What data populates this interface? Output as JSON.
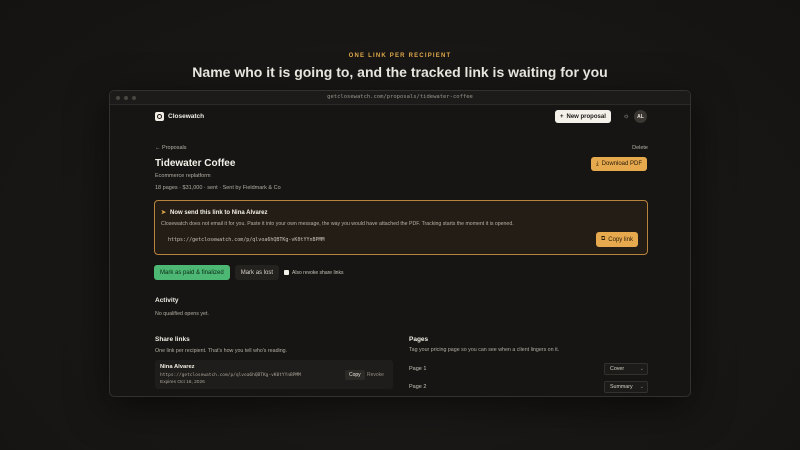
{
  "promo": {
    "eyebrow": "ONE LINK PER RECIPIENT",
    "headline": "Name who it is going to, and the tracked link is waiting for you"
  },
  "browser": {
    "url": "getclosewatch.com/proposals/tidewater-coffee"
  },
  "app": {
    "brand": "Closewatch",
    "new_proposal": "New proposal",
    "new_proposal_icon": "+",
    "theme_icon": "☼",
    "avatar_initials": "AL"
  },
  "proposal": {
    "breadcrumb": "Proposals",
    "back_icon": "←",
    "delete": "Delete",
    "title": "Tidewater Coffee",
    "subtitle": "Ecommerce replatform",
    "meta": "18 pages · $31,000 · sent · Sent by Fieldmark & Co",
    "download": "Download PDF",
    "download_icon": "⤓"
  },
  "callout": {
    "icon": "➤",
    "title": "Now send this link to Nina Alvarez",
    "description": "Closewatch does not email it for you. Paste it into your own message, the way you would have attached the PDF. Tracking starts the moment it is opened.",
    "link": "https://getclosewatch.com/p/qlvoa6hQBTKg-vK0tYYnBPMM",
    "copy": "Copy link",
    "copy_icon": "⧉"
  },
  "actions": {
    "mark_paid": "Mark as paid & finalized",
    "mark_lost": "Mark as lost",
    "revoke_label": "Also revoke share links"
  },
  "activity": {
    "title": "Activity",
    "empty": "No qualified opens yet."
  },
  "share_links": {
    "title": "Share links",
    "description": "One link per recipient. That's how you tell who's reading.",
    "items": [
      {
        "name": "Nina Alvarez",
        "url": "https://getclosewatch.com/p/qlvoa6hQBTKg-vK0tYYnBPMM",
        "expires": "Expires Oct 16, 2026",
        "copy": "Copy",
        "revoke": "Revoke"
      }
    ]
  },
  "pages": {
    "title": "Pages",
    "description": "Tag your pricing page so you can see when a client lingers on it.",
    "items": [
      {
        "label": "Page 1",
        "tag": "Cover"
      },
      {
        "label": "Page 2",
        "tag": "Summary"
      }
    ]
  },
  "colors": {
    "accent": "#e6a94e",
    "success": "#4cb873",
    "background": "#161514"
  }
}
